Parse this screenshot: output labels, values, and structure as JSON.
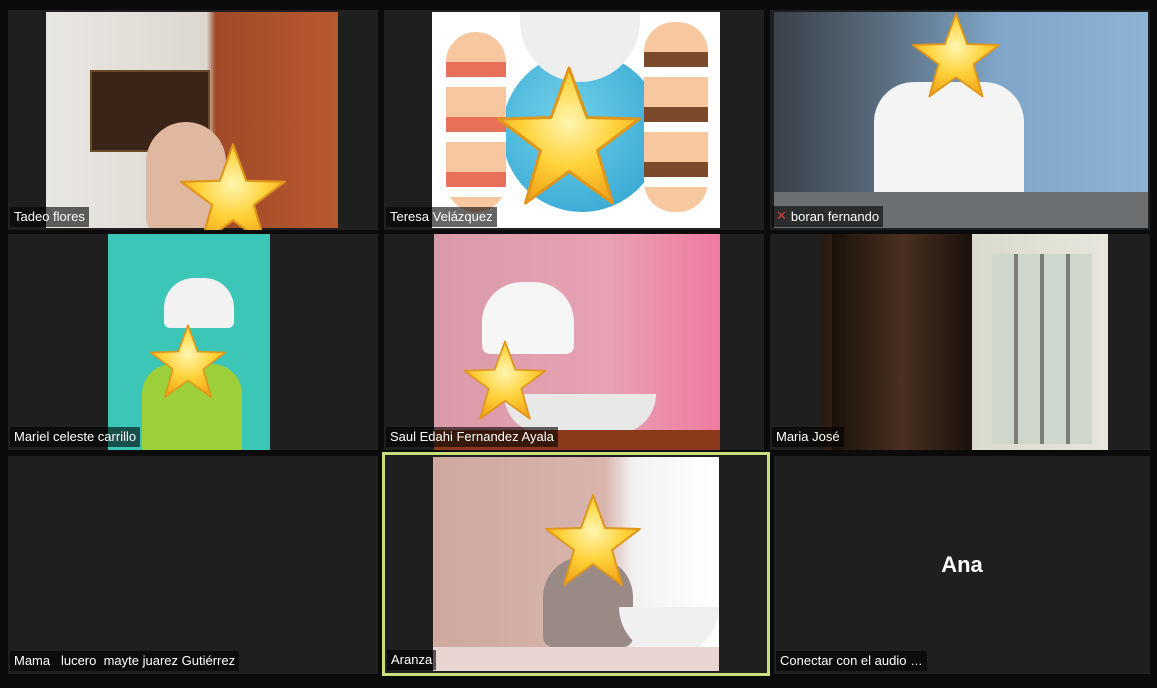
{
  "participants": [
    {
      "name": "Tadeo flores"
    },
    {
      "name": "Teresa Velázquez"
    },
    {
      "name": "boran fernando",
      "muted": true
    },
    {
      "name": "Mariel celeste carrillo"
    },
    {
      "name": "Saul Edahi Fernandez Ayala"
    },
    {
      "name": "Maria José"
    },
    {
      "name": "Mama   lucero  mayte juarez Gutiérrez"
    },
    {
      "name": "Aranza",
      "active_speaker": true
    },
    {
      "name": "Conectar con el audio",
      "display_name": "Ana"
    }
  ],
  "icons": {
    "muted": "microphone-muted-icon",
    "more": "more-options-icon",
    "face_cover": "star-icon"
  },
  "colors": {
    "active_speaker_border": "#c9e07a",
    "muted_icon": "#e23b3b"
  }
}
